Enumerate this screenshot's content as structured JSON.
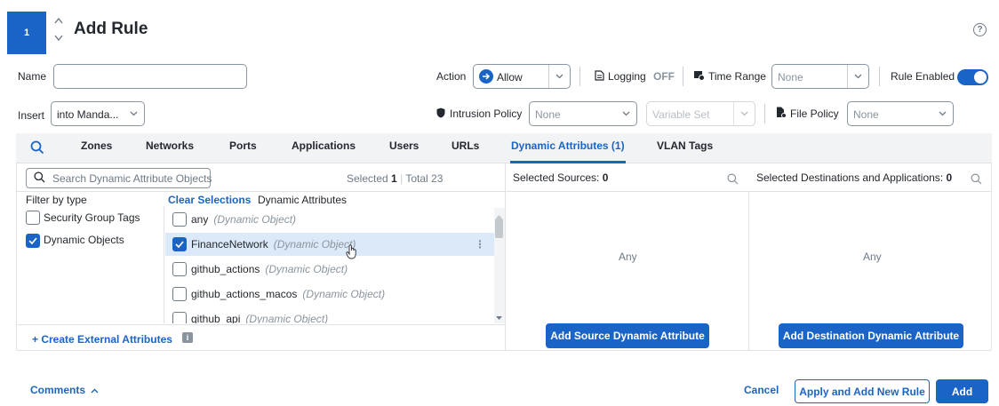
{
  "header": {
    "step_number": "1",
    "title": "Add Rule"
  },
  "form": {
    "name_label": "Name",
    "name_value": "",
    "insert_label": "Insert",
    "insert_value": "into Manda...",
    "action_label": "Action",
    "action_value": "Allow",
    "logging_label": "Logging",
    "logging_value": "OFF",
    "time_range_label": "Time Range",
    "time_range_value": "None",
    "rule_enabled_label": "Rule Enabled",
    "rule_enabled": true,
    "intrusion_policy_label": "Intrusion Policy",
    "intrusion_policy_value": "None",
    "variable_set_placeholder": "Variable Set",
    "file_policy_label": "File Policy",
    "file_policy_value": "None"
  },
  "tabs": [
    {
      "label": "Zones"
    },
    {
      "label": "Networks"
    },
    {
      "label": "Ports"
    },
    {
      "label": "Applications"
    },
    {
      "label": "Users"
    },
    {
      "label": "URLs"
    },
    {
      "label": "Dynamic Attributes (1)",
      "active": true
    },
    {
      "label": "VLAN Tags"
    }
  ],
  "search": {
    "placeholder": "Search Dynamic Attribute Objects",
    "selected_label": "Selected",
    "selected_count": "1",
    "total_label": "Total",
    "total_count": "23"
  },
  "filter": {
    "title": "Filter by type",
    "options": [
      {
        "label": "Security Group Tags",
        "checked": false
      },
      {
        "label": "Dynamic Objects",
        "checked": true
      }
    ]
  },
  "list": {
    "clear_label": "Clear Selections",
    "header": "Dynamic Attributes",
    "items": [
      {
        "name": "any",
        "type": "(Dynamic Object)",
        "checked": false
      },
      {
        "name": "FinanceNetwork",
        "type": "(Dynamic Object)",
        "checked": true
      },
      {
        "name": "github_actions",
        "type": "(Dynamic Object)",
        "checked": false
      },
      {
        "name": "github_actions_macos",
        "type": "(Dynamic Object)",
        "checked": false
      },
      {
        "name": "github_api",
        "type": "(Dynamic Object)",
        "checked": false
      }
    ]
  },
  "create_external_label": "+ Create External Attributes",
  "sources": {
    "title": "Selected Sources:",
    "count": "0",
    "empty": "Any",
    "add_button": "Add Source Dynamic Attribute"
  },
  "destinations": {
    "title": "Selected Destinations and Applications:",
    "count": "0",
    "empty": "Any",
    "add_button": "Add Destination Dynamic Attribute"
  },
  "footer": {
    "comments_label": "Comments",
    "cancel_label": "Cancel",
    "apply_new_label": "Apply and Add New Rule",
    "add_label": "Add"
  },
  "colors": {
    "accent": "#1a64c8",
    "selected_row": "#dce9f8"
  }
}
